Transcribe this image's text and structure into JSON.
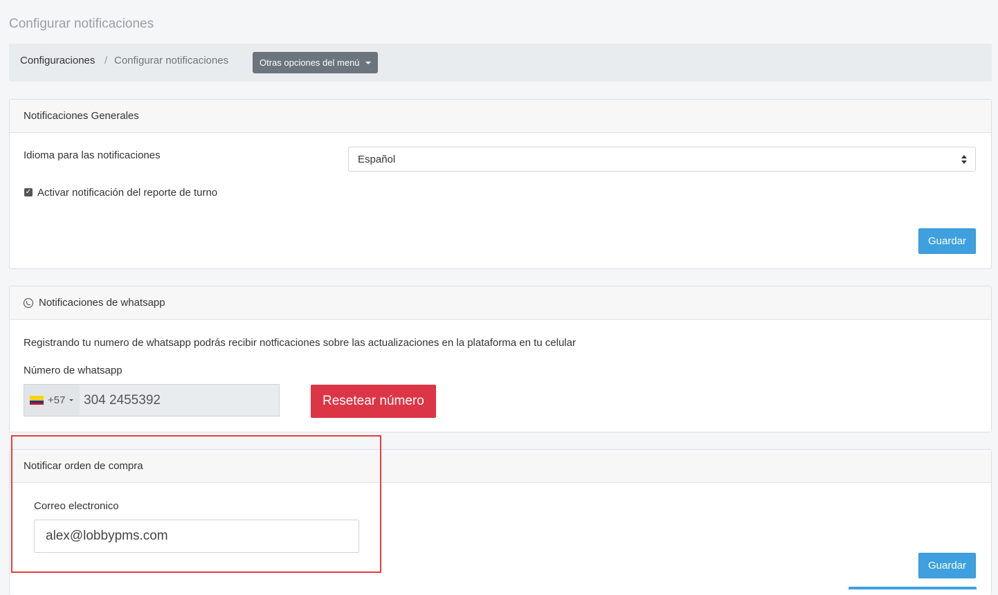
{
  "page": {
    "title": "Configurar notificaciones"
  },
  "breadcrumb": {
    "root": "Configuraciones",
    "separator": "/",
    "current": "Configurar notificaciones",
    "menu_button": "Otras opciones del menú"
  },
  "general": {
    "header": "Notificaciones Generales",
    "language_label": "Idioma para las notificaciones",
    "language_value": "Español",
    "checkbox_label": "Activar notificación del reporte de turno",
    "checkbox_checked": true,
    "save_label": "Guardar"
  },
  "whatsapp": {
    "header": "Notificaciones de whatsapp",
    "icon": "whatsapp-icon",
    "description": "Registrando tu numero de whatsapp podrás recibir notficaciones sobre las actualizaciones en la plataforma en tu celular",
    "number_label": "Número de whatsapp",
    "dial_code": "+57",
    "number_value": "304 2455392",
    "reset_label": "Resetear número"
  },
  "purchase": {
    "header": "Notificar orden de compra",
    "email_label": "Correo electronico",
    "email_value": "alex@lobbypms.com",
    "save_label": "Guardar"
  },
  "colors": {
    "primary": "#3ea0de",
    "danger": "#dc3545",
    "secondary": "#6c757d",
    "highlight": "#e53d3d"
  }
}
